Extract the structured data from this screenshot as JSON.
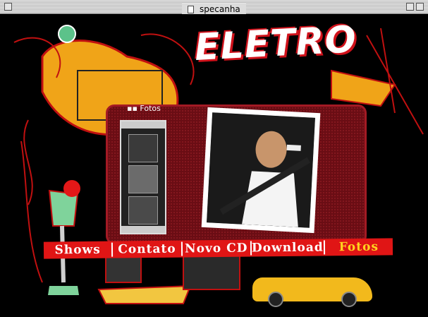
{
  "window": {
    "title": "specanha"
  },
  "site": {
    "logo_text": "ELETRO",
    "section_label": "▪▪ Fotos"
  },
  "nav": {
    "items": [
      {
        "id": "shows",
        "label": "Shows"
      },
      {
        "id": "contato",
        "label": "Contato"
      },
      {
        "id": "novo-cd",
        "label": "Novo CD"
      },
      {
        "id": "download",
        "label": "Download"
      },
      {
        "id": "fotos",
        "label": "Fotos"
      }
    ]
  },
  "colors": {
    "accent_red": "#e01515",
    "active_nav": "#ffd21e",
    "taxi_yellow": "#f2b91c"
  }
}
